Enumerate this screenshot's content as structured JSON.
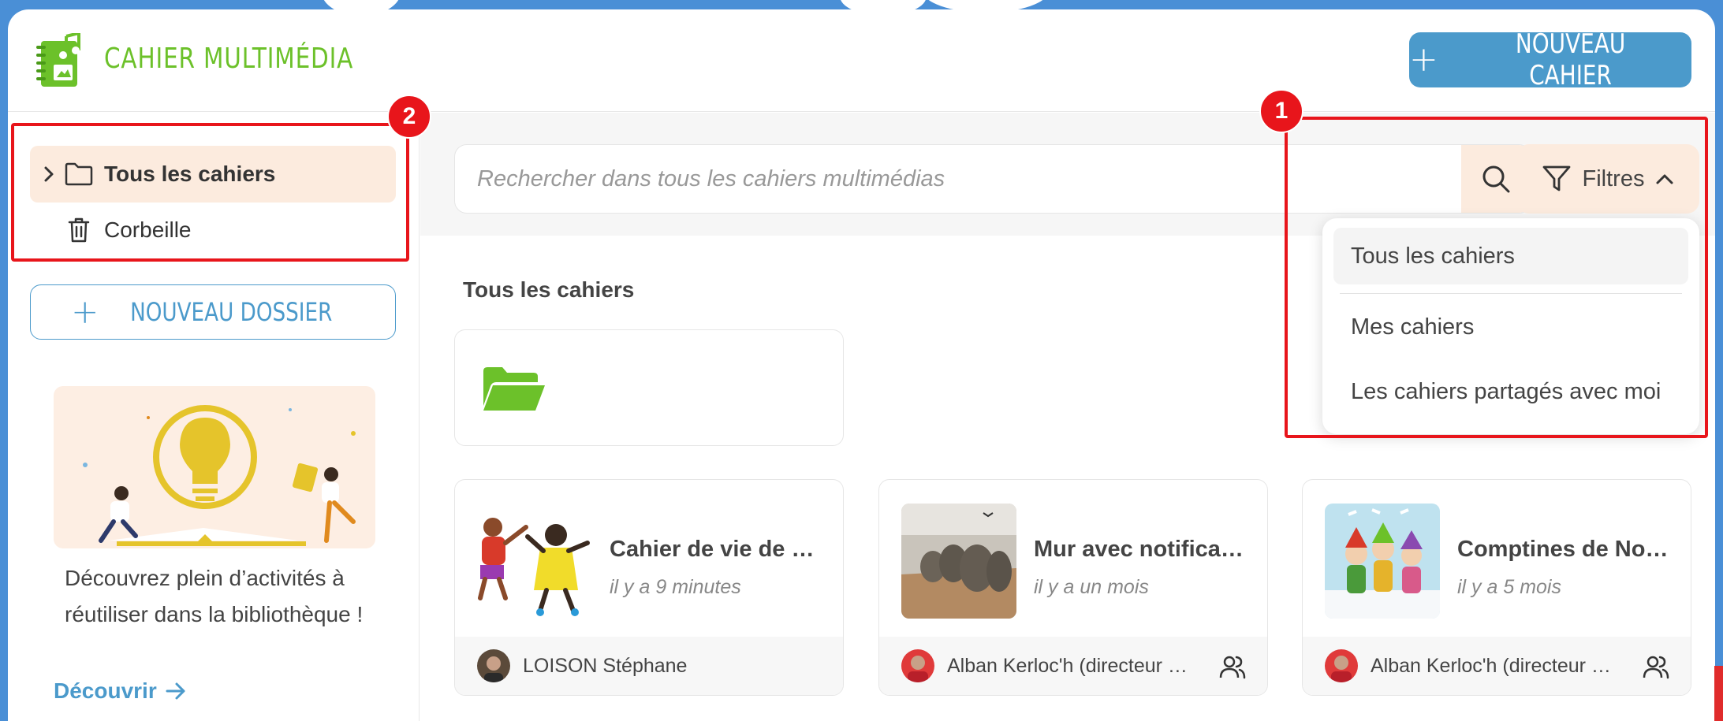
{
  "header": {
    "app_title": "CAHIER MULTIMÉDIA",
    "new_notebook_label": "NOUVEAU CAHIER"
  },
  "sidebar": {
    "items": [
      {
        "label": "Tous les cahiers",
        "icon": "folder-icon",
        "active": true
      },
      {
        "label": "Corbeille",
        "icon": "trash-icon",
        "active": false
      }
    ],
    "new_folder_label": "NOUVEAU DOSSIER",
    "promo": {
      "text": "Découvrez plein d’activités à réutiliser dans la bibliothèque !",
      "link_label": "Découvrir"
    }
  },
  "search": {
    "placeholder": "Rechercher dans tous les cahiers multimédias",
    "filter_label": "Filtres"
  },
  "filter_menu": {
    "options": [
      "Tous les cahiers",
      "Mes cahiers",
      "Les cahiers partagés avec moi"
    ],
    "selected": "Tous les cahiers"
  },
  "main": {
    "section_title": "Tous les cahiers",
    "notebooks": [
      {
        "title": "Cahier de vie de …",
        "date": "il y a 9 minutes",
        "owner": "LOISON Stéphane",
        "shared": false
      },
      {
        "title": "Mur avec notifica…",
        "date": "il y a un mois",
        "owner": "Alban Kerloc'h (directeur …",
        "shared": true
      },
      {
        "title": "Comptines de No…",
        "date": "il y a 5 mois",
        "owner": "Alban Kerloc'h (directeur …",
        "shared": true
      }
    ]
  },
  "annotations": [
    "1",
    "2"
  ],
  "colors": {
    "brand_green": "#6cc12a",
    "accent_blue": "#4b9acb",
    "highlight_peach": "#fcebde",
    "annotation_red": "#e8151b",
    "page_background": "#4a8fd6"
  }
}
